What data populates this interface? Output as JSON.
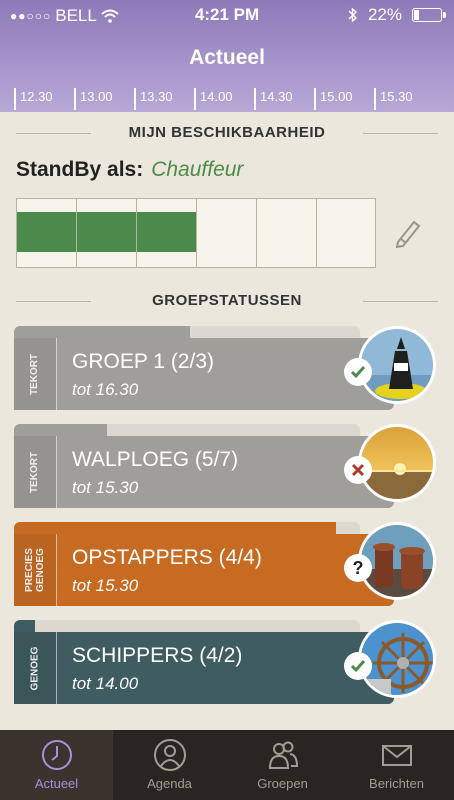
{
  "status": {
    "carrier": "BELL",
    "time": "4:21 PM",
    "battery": "22%",
    "signal_dots": "●●○○○"
  },
  "header": {
    "title": "Actueel"
  },
  "timeline": [
    "12.30",
    "13.00",
    "13.30",
    "14.00",
    "14.30",
    "15.00",
    "15.30"
  ],
  "availability": {
    "section_title": "MIJN BESCHIKBAARHEID",
    "standby_label": "StandBy als:",
    "role": "Chauffeur",
    "filled_fraction": 0.5
  },
  "groups": {
    "section_title": "GROEPSTATUSSEN",
    "items": [
      {
        "status": "TEKORT",
        "name": "GROEP 1 (2/3)",
        "until": "tot 16.30",
        "badge": "check-icon",
        "progress": 0.51
      },
      {
        "status": "TEKORT",
        "name": "WALPLOEG (5/7)",
        "until": "tot 15.30",
        "badge": "cross-icon",
        "progress": 0.27
      },
      {
        "status": "PRECIES GENOEG",
        "name": "OPSTAPPERS (4/4)",
        "until": "tot 15.30",
        "badge": "question-icon",
        "progress": 0.93
      },
      {
        "status": "GENOEG",
        "name": "SCHIPPERS (4/2)",
        "until": "tot 14.00",
        "badge": "check-icon",
        "progress": 0.06
      }
    ]
  },
  "colors": {
    "tekort": "#a09e9b",
    "precies": "#c76b23",
    "genoeg": "#3f5c60",
    "green": "#4b8a4a",
    "accent": "#a890dc"
  },
  "tabs": [
    {
      "label": "Actueel",
      "icon": "clock-icon",
      "active": true
    },
    {
      "label": "Agenda",
      "icon": "person-icon",
      "active": false
    },
    {
      "label": "Groepen",
      "icon": "group-icon",
      "active": false
    },
    {
      "label": "Berichten",
      "icon": "envelope-icon",
      "active": false
    }
  ]
}
